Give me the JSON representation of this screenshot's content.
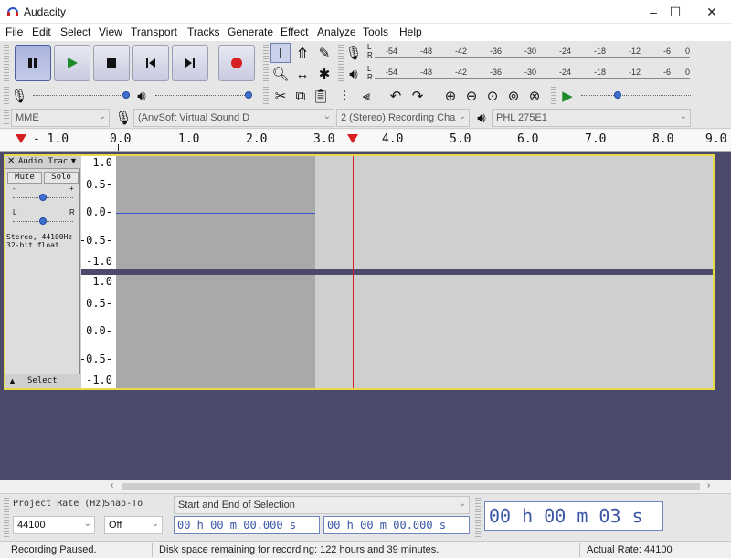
{
  "window": {
    "title": "Audacity"
  },
  "menu": [
    "File",
    "Edit",
    "Select",
    "View",
    "Transport",
    "Tracks",
    "Generate",
    "Effect",
    "Analyze",
    "Tools",
    "Help"
  ],
  "meter": {
    "play_scale": [
      "-54",
      "-48",
      "-42",
      "-36",
      "-30",
      "-24",
      "-18",
      "-12",
      "-6",
      "0"
    ],
    "rec_scale": [
      "-54",
      "-48",
      "-42",
      "-36",
      "-30",
      "-24",
      "-18",
      "-12",
      "-6",
      "0"
    ],
    "channels": [
      "L",
      "R"
    ]
  },
  "devices": {
    "host": "MME",
    "recording_device": "(AnvSoft Virtual Sound D",
    "channels": "2 (Stereo) Recording Cha",
    "playback_device": "PHL 275E1"
  },
  "ruler": [
    "- 1.0",
    "0.0",
    "1.0",
    "2.0",
    "3.0",
    "4.0",
    "5.0",
    "6.0",
    "7.0",
    "8.0",
    "9.0"
  ],
  "track": {
    "name": "Audio Trac",
    "mute": "Mute",
    "solo": "Solo",
    "gain_minus": "-",
    "gain_plus": "+",
    "pan_left": "L",
    "pan_right": "R",
    "info_line1": "Stereo, 44100Hz",
    "info_line2": "32-bit float",
    "select": "Select",
    "scale": [
      "1.0",
      "0.5-",
      "0.0-",
      "-0.5-",
      "-1.0"
    ],
    "scale2": [
      "1.0",
      "0.5-",
      "0.0-",
      "-0.5-",
      "-1.0"
    ]
  },
  "selection_toolbar": {
    "project_rate_label": "Project Rate (Hz)",
    "project_rate_value": "44100",
    "snap_label": "Snap-To",
    "snap_value": "Off",
    "selection_mode": "Start and End of Selection",
    "start_time": "00 h 00 m 00.000 s",
    "end_time": "00 h 00 m 00.000 s",
    "audio_position": "00 h 00 m 03 s"
  },
  "status": {
    "state": "Recording Paused.",
    "disk": "Disk space remaining for recording: 122 hours and 39 minutes.",
    "rate": "Actual Rate: 44100"
  },
  "colors": {
    "accent": "#3f6fd1",
    "track_border": "#e6d94a",
    "track_bg": "#4b4a6a",
    "record": "#d42020"
  }
}
